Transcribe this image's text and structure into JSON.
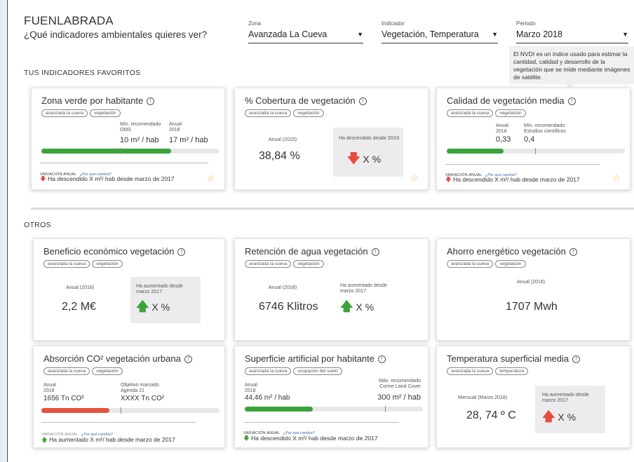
{
  "header": {
    "title": "FUENLABRADA",
    "subtitle": "¿Qué indicadores ambientales quieres ver?"
  },
  "filters": {
    "zona": {
      "label": "Zona",
      "value": "Avanzada La Cueva"
    },
    "indicador": {
      "label": "Indicador",
      "value": "Vegetación, Temperatura"
    },
    "periodo": {
      "label": "Periodo",
      "value": "Marzo 2018"
    }
  },
  "tooltip": {
    "lines": [
      "El NVDI es un índice usado para estimar la",
      "cantidad, calidad y desarrollo de la",
      "vegetación que se mide mediante imágenes",
      "de satélite."
    ]
  },
  "sections": {
    "favorites": "TUS INDICADORES FAVORITOS",
    "others": "OTROS"
  },
  "common": {
    "var_title": "VARIACIÓN ANUAL",
    "var_link": "¿Por qué cambia?",
    "tag_zone": "avanzada la cueva",
    "tag_veg": "vegetación",
    "tag_temp": "temperatura",
    "tag_suelo": "ocupación del suelo"
  },
  "cards": {
    "c1": {
      "title": "Zona verde por habitante",
      "min_label_1": "Mín. recomendado",
      "min_label_2": "OMS",
      "min_value": "10 m² / hab",
      "annual_label_1": "Anual",
      "annual_label_2": "2018",
      "annual_value": "17 m² / hab",
      "progress": 0.73,
      "var_text": "Ha descendido X m²/ hab desde marzo de 2017"
    },
    "c2": {
      "title": "% Cobertura de vegetación",
      "period": "Anual (2015)",
      "value": "38,84 %",
      "change_label": "Ha descendido desde 20XX",
      "change_value": "X %"
    },
    "c3": {
      "title": "Calidad de vegetación media",
      "annual_label_1": "Anual",
      "annual_label_2": "2018",
      "annual_value": "0,33",
      "min_label_1": "Mín. recomendado",
      "min_label_2": "Estudios científicos",
      "min_value": "0,4",
      "progress": 0.32,
      "var_text": "Ha descendido X m²/ hab desde marzo de 2017"
    },
    "c4": {
      "title": "Beneficio económico vegetación",
      "period": "Anual (2018)",
      "value": "2,2 M€",
      "change_label_1": "Ha aumentado desde",
      "change_label_2": "marzo 2017",
      "change_value": "X %"
    },
    "c5": {
      "title": "Retención de agua vegetación",
      "period": "Anual (2018)",
      "value": "6746 Klitros",
      "change_label_1": "Ha aumentado desde",
      "change_label_2": "marzo 2017",
      "change_value": "X %"
    },
    "c6": {
      "title": "Ahorro energético vegetación",
      "period": "Anual (2018)",
      "value": "1707 Mwh"
    },
    "c7": {
      "title": "Absorción CO² vegetación urbana",
      "annual_label_1": "Anual",
      "annual_label_2": "2018",
      "annual_value": "1656 Tn CO²",
      "goal_label_1": "Objetivo marcado",
      "goal_label_2": "Agenda 21",
      "goal_value": "XXXX Tn CO²",
      "progress": 0.38,
      "var_text": "Ha aumentado X m²/ hab desde marzo de 2017"
    },
    "c8": {
      "title": "Superficie artificial por habitante",
      "annual_label_1": "Anual",
      "annual_label_2": "2018",
      "annual_value": "44,46 m² / hab",
      "max_label_1": "Máx. recomendado",
      "max_label_2": "Corine Land Cover",
      "max_value": "300 m² / hab",
      "progress": 0.38,
      "var_text": "Ha descendido X m²/ hab desde marzo de 2017"
    },
    "c9": {
      "title": "Temperatura superficial media",
      "period": "Mensual (Marzo 2018)",
      "value": "28, 74 º C",
      "change_label_1": "Ha aumentado desde",
      "change_label_2": "marzo 2017",
      "change_value": "X %"
    }
  },
  "colors": {
    "green": "#3aa33a",
    "red": "#e5533d",
    "star": "#f2b632"
  }
}
